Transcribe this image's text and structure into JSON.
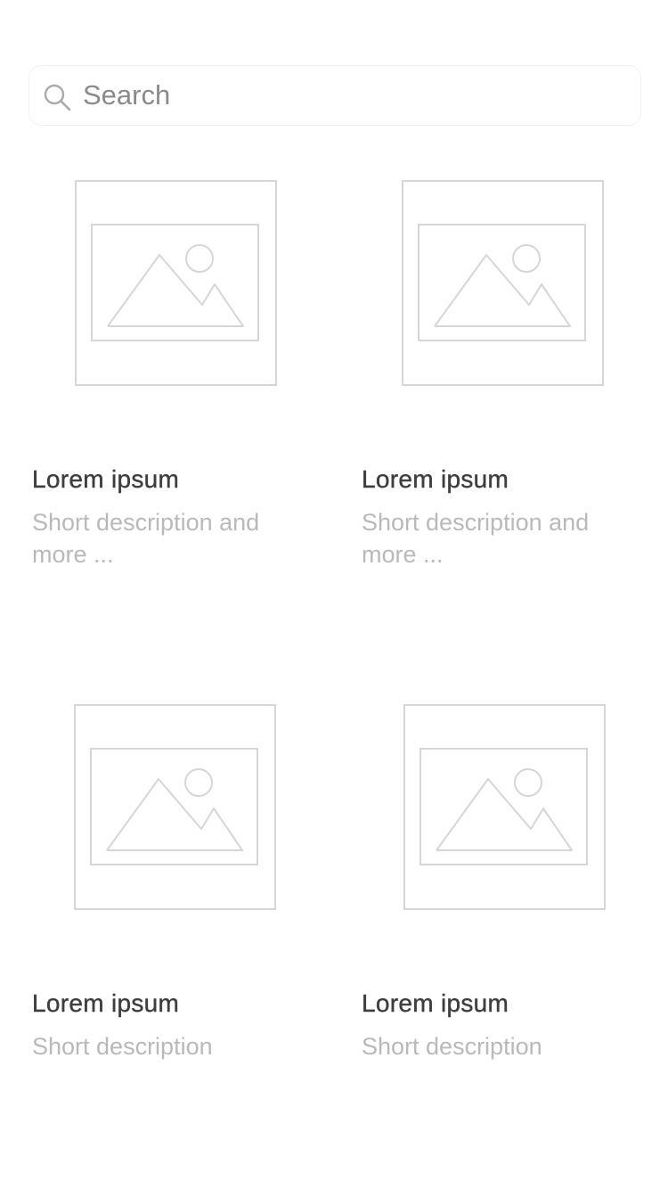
{
  "search": {
    "placeholder": "Search",
    "icon": "search-icon"
  },
  "cards": [
    {
      "title": "Lorem ipsum",
      "description": "Short description and more ...",
      "image_icon": "image-placeholder-icon"
    },
    {
      "title": "Lorem ipsum",
      "description": "Short description and more ...",
      "image_icon": "image-placeholder-icon"
    },
    {
      "title": "Lorem ipsum",
      "description": "Short description",
      "image_icon": "image-placeholder-icon"
    },
    {
      "title": "Lorem ipsum",
      "description": "Short description",
      "image_icon": "image-placeholder-icon"
    }
  ],
  "colors": {
    "title": "#3e3e3e",
    "description": "#b9b9b9",
    "placeholder_line": "#d6d6d6",
    "search_text": "#8a8a8a"
  }
}
